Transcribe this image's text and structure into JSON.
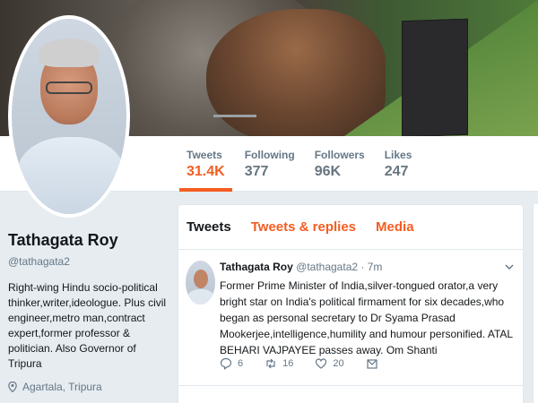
{
  "stats": [
    {
      "label": "Tweets",
      "value": "31.4K"
    },
    {
      "label": "Following",
      "value": "377"
    },
    {
      "label": "Followers",
      "value": "96K"
    },
    {
      "label": "Likes",
      "value": "247"
    }
  ],
  "profile": {
    "name": "Tathagata Roy",
    "handle": "@tathagata2",
    "bio": "Right-wing Hindu socio-political thinker,writer,ideologue. Plus civil engineer,metro man,contract expert,former professor & politician. Also Governor of Tripura",
    "location": "Agartala, Tripura"
  },
  "timeline": {
    "tabs": [
      "Tweets",
      "Tweets & replies",
      "Media"
    ]
  },
  "tweet": {
    "author": "Tathagata Roy",
    "handle": "@tathagata2",
    "time": "· 7m",
    "text": "Former Prime Minister of India,silver-tongued orator,a very bright star on India's political firmament for six decades,who began as personal secretary to Dr Syama Prasad Mookerjee,intelligence,humility and humour  personified. ATAL BEHARI VAJPAYEE passes away. Om Shanti",
    "replies": "6",
    "retweets": "16",
    "likes": "20"
  },
  "colors": {
    "accent": "#f45d22",
    "muted": "#657786",
    "background": "#e6ecf0"
  }
}
